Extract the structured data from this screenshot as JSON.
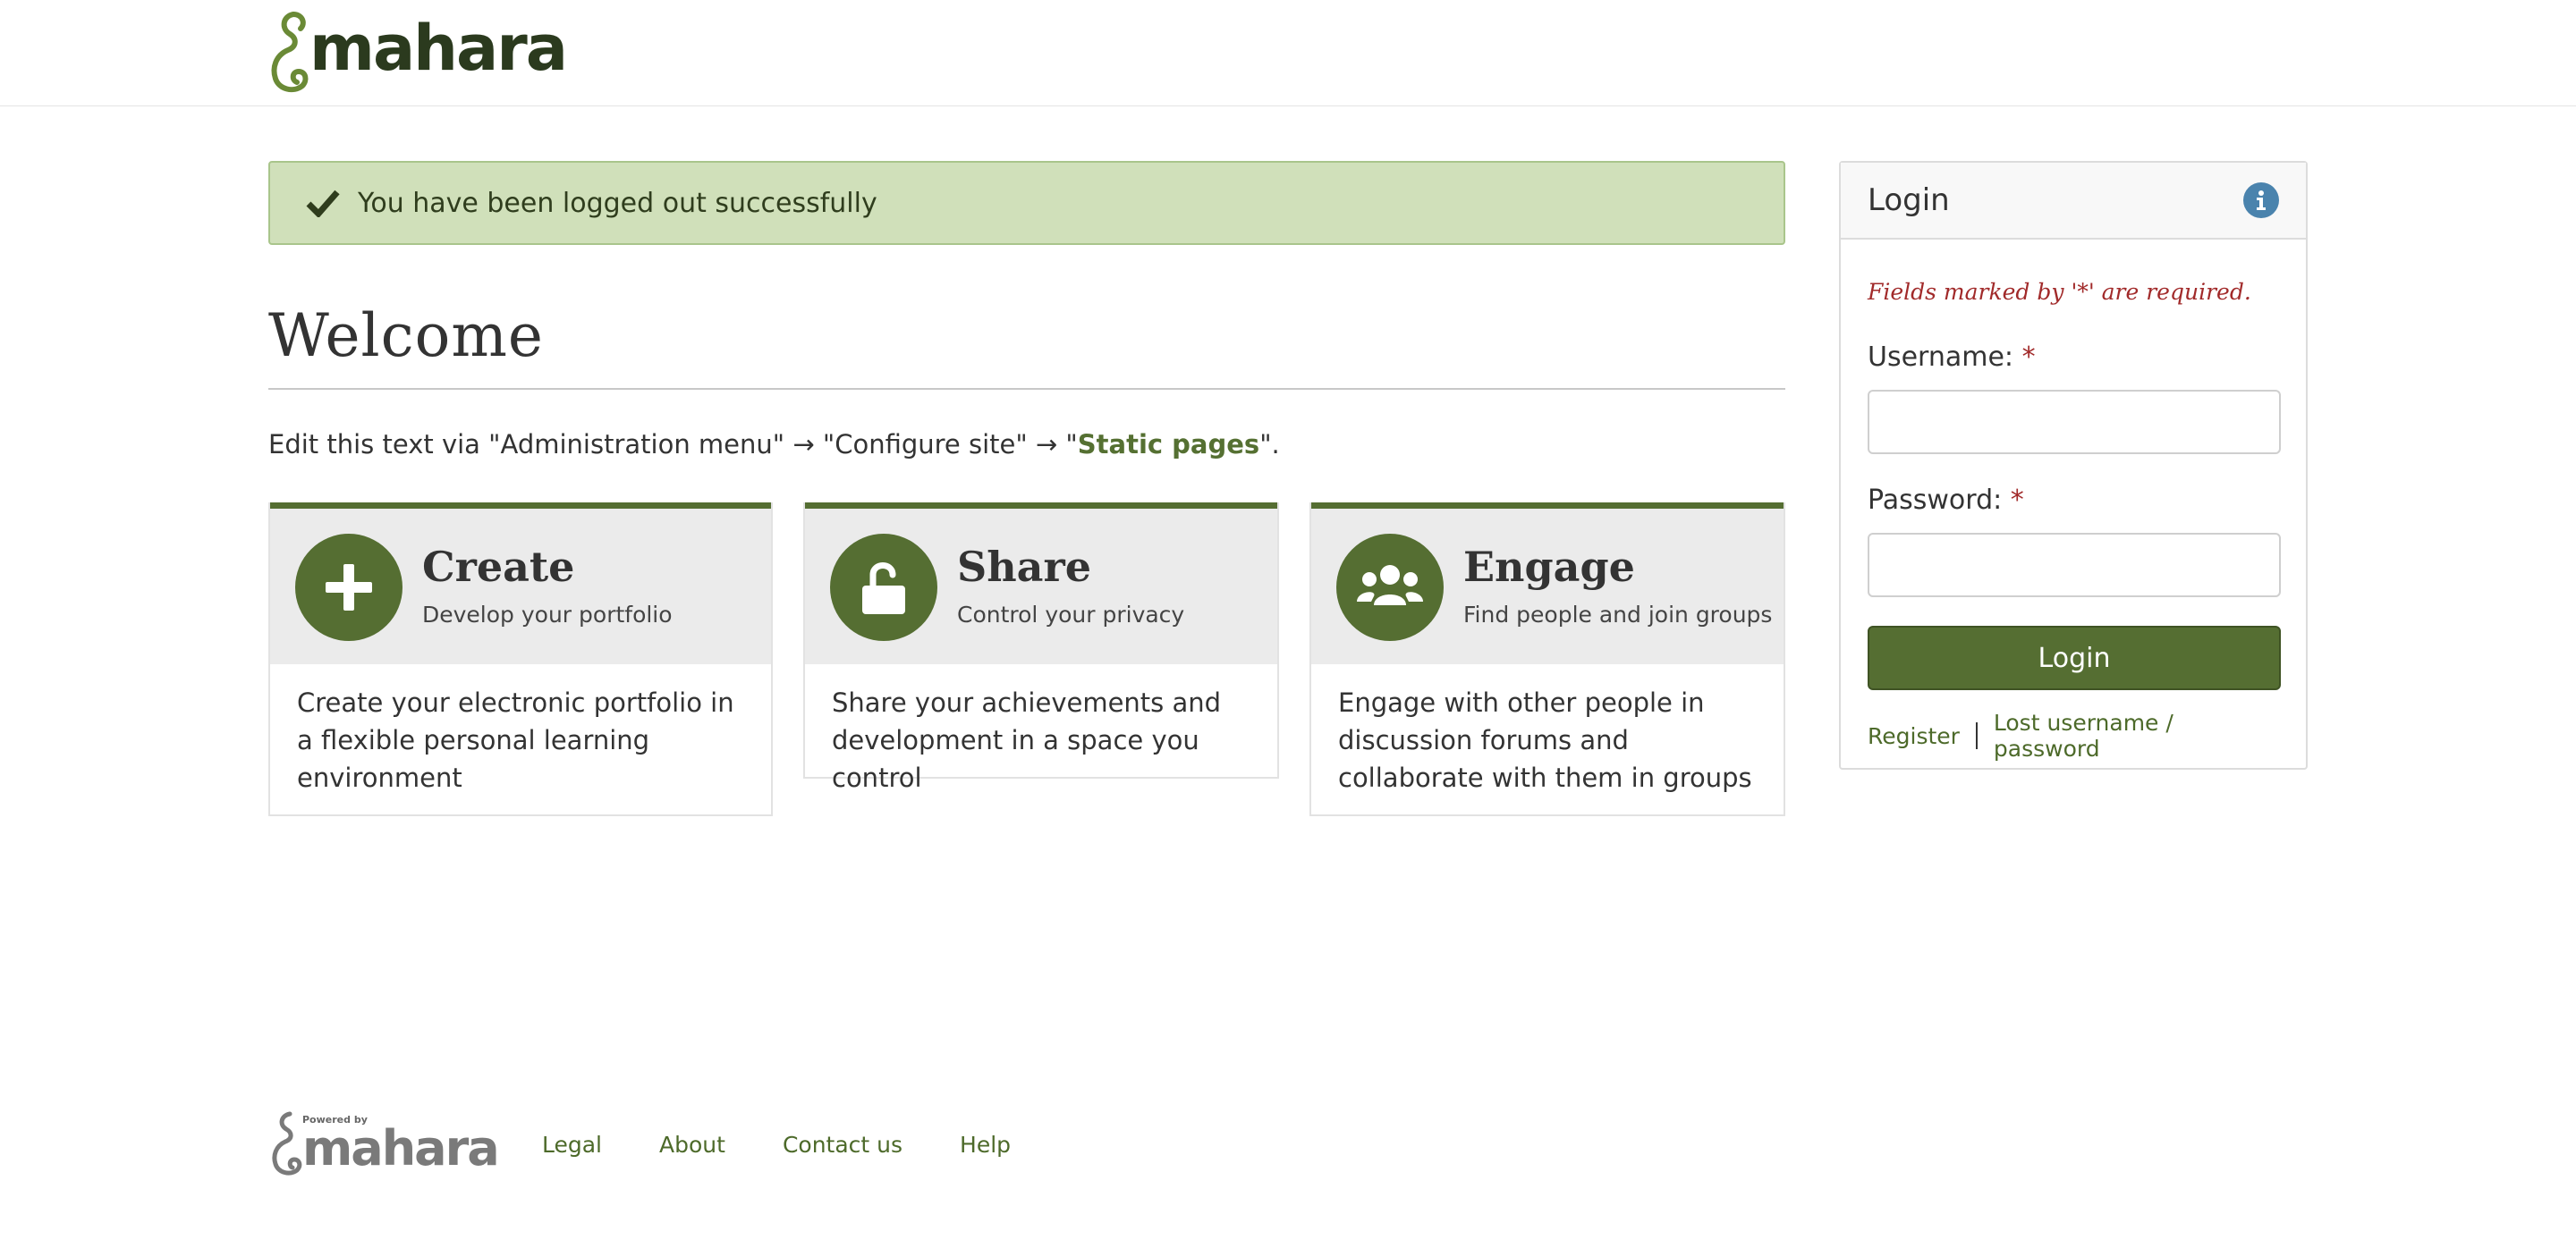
{
  "header": {
    "logo_text": "mahara"
  },
  "alert": {
    "message": "You have been logged out successfully"
  },
  "main": {
    "title": "Welcome",
    "intro_prefix": "Edit this text via \"Administration menu\" → \"Configure site\" → \"",
    "intro_link": "Static pages",
    "intro_suffix": "\"."
  },
  "cards": [
    {
      "title": "Create",
      "subtitle": "Develop your portfolio",
      "body": "Create your electronic portfolio in a flexible personal learning environment",
      "icon": "plus-icon"
    },
    {
      "title": "Share",
      "subtitle": "Control your privacy",
      "body": "Share your achievements and development in a space you control",
      "icon": "unlock-icon"
    },
    {
      "title": "Engage",
      "subtitle": "Find people and join groups",
      "body": "Engage with other people in discussion forums and collaborate with them in groups",
      "icon": "users-icon"
    }
  ],
  "login": {
    "title": "Login",
    "required_note": "Fields marked by '*' are required.",
    "username_label": "Username:",
    "password_label": "Password:",
    "required_marker": "*",
    "username_value": "",
    "password_value": "",
    "button_label": "Login",
    "register_link": "Register",
    "lost_link": "Lost username / password"
  },
  "footer": {
    "powered_by": "Powered by",
    "logo_text": "mahara",
    "links": [
      "Legal",
      "About",
      "Contact us",
      "Help"
    ]
  },
  "colors": {
    "brand_green": "#556e32",
    "alert_bg": "#d0e0ba",
    "required_red": "#a12a2a",
    "info_blue": "#4a83ad"
  }
}
